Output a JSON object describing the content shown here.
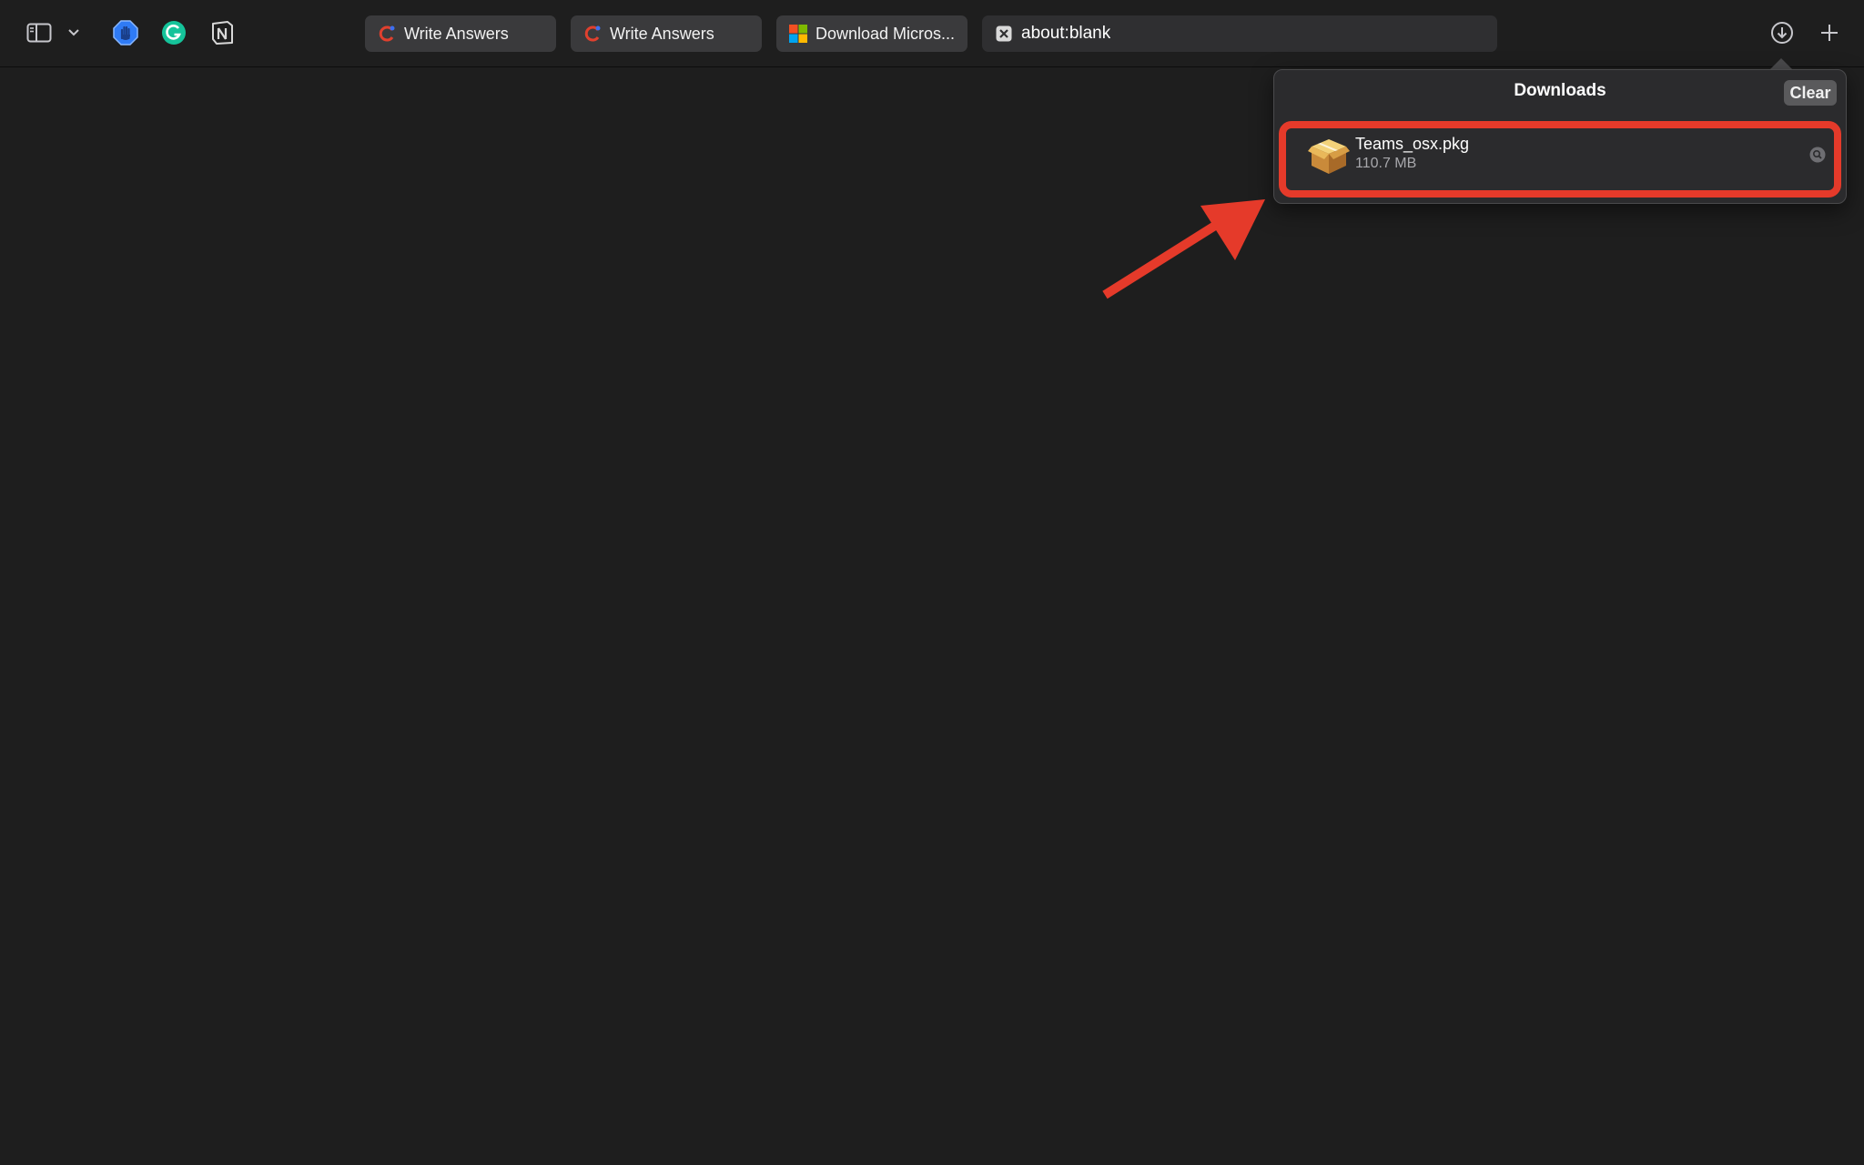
{
  "toolbar": {
    "sidebar_toggle_icon": "sidebar-icon",
    "sidebar_menu_icon": "chevron-down-icon",
    "extensions": [
      {
        "name": "adblock",
        "icon": "hand-stop-icon",
        "color": "#2f7bf5"
      },
      {
        "name": "grammarly",
        "icon": "grammarly-icon",
        "color": "#15c39a"
      },
      {
        "name": "notion",
        "icon": "notion-icon",
        "color": "#d8d8d8"
      }
    ],
    "downloads_icon": "download-circle-icon",
    "new_tab_icon": "plus-icon"
  },
  "tabs": [
    {
      "label": "Write Answers",
      "icon": "write-answers-favicon"
    },
    {
      "label": "Write Answers",
      "icon": "write-answers-favicon"
    },
    {
      "label": "Download Micros...",
      "icon": "microsoft-logo-icon"
    },
    {
      "label": "about:blank",
      "icon": "close-tab-icon",
      "active": true
    }
  ],
  "downloads": {
    "title": "Downloads",
    "clear_label": "Clear",
    "items": [
      {
        "file_name": "Teams_osx.pkg",
        "size": "110.7 MB",
        "icon": "package-icon",
        "action_icon": "magnifier-icon"
      }
    ]
  },
  "annotation": {
    "highlight_color": "#e53a2a",
    "arrow_color": "#e53a2a"
  },
  "colors": {
    "background": "#1e1e1e",
    "popover_bg": "#2b2b2d",
    "tab_bg": "#3a3a3c"
  }
}
